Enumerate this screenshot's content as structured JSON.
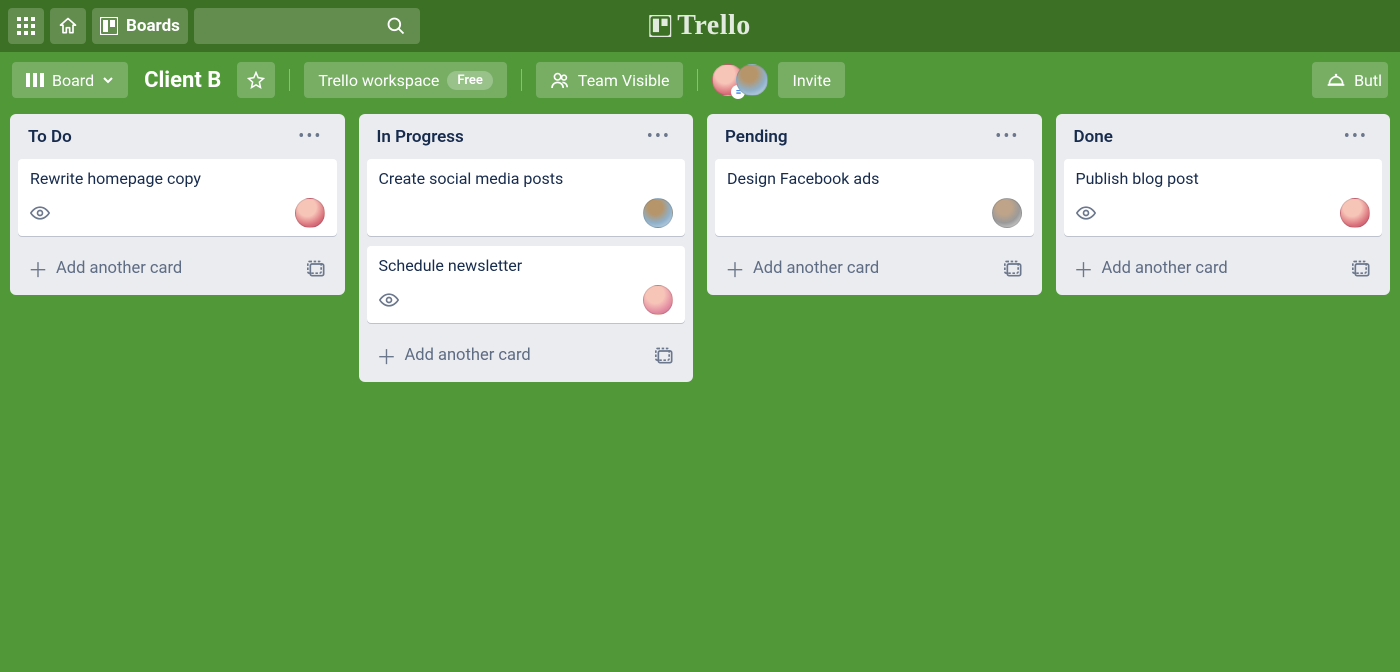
{
  "nav": {
    "boards_label": "Boards",
    "logo_text": "Trello"
  },
  "boardbar": {
    "view_label": "Board",
    "board_title": "Client B",
    "workspace_label": "Trello workspace",
    "workspace_plan": "Free",
    "visibility_label": "Team Visible",
    "invite_label": "Invite",
    "butler_label": "Butl"
  },
  "lists": [
    {
      "title": "To Do",
      "cards": [
        {
          "title": "Rewrite homepage copy",
          "watch": true,
          "avatar": "pink"
        }
      ],
      "add_label": "Add another card"
    },
    {
      "title": "In Progress",
      "cards": [
        {
          "title": "Create social media posts",
          "watch": false,
          "avatar": "blue"
        },
        {
          "title": "Schedule newsletter",
          "watch": true,
          "avatar": "pink2"
        }
      ],
      "add_label": "Add another card"
    },
    {
      "title": "Pending",
      "cards": [
        {
          "title": "Design Facebook ads",
          "watch": false,
          "avatar": "gray"
        }
      ],
      "add_label": "Add another card"
    },
    {
      "title": "Done",
      "cards": [
        {
          "title": "Publish blog post",
          "watch": true,
          "avatar": "pink"
        }
      ],
      "add_label": "Add another card"
    }
  ]
}
